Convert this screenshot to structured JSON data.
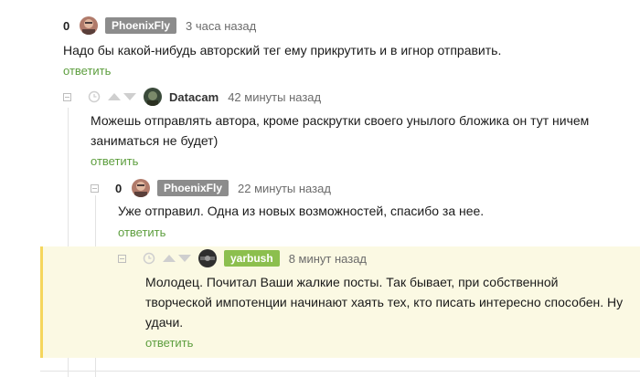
{
  "colors": {
    "reply_link": "#5d9e3e",
    "phoenix_badge": "#8c8c8c",
    "yarbush_badge": "#8cbf4e",
    "highlight_bg": "#fbf9e3",
    "highlight_border": "#f5d65c"
  },
  "comments": [
    {
      "score": "0",
      "author": "PhoenixFly",
      "time": "3 часа назад",
      "text": "Надо бы какой-нибудь авторский тег ему прикрутить и в игнор отправить.",
      "reply_label": "ответить"
    },
    {
      "author": "Datacam",
      "time": "42 минуты назад",
      "text_line1": "Можешь отправлять автора, кроме раскрутки своего унылого бложика он тут ничем",
      "text_line2": "заниматься не будет)",
      "reply_label": "ответить"
    },
    {
      "score": "0",
      "author": "PhoenixFly",
      "time": "22 минуты назад",
      "text": "Уже отправил. Одна из новых возможностей, спасибо за нее.",
      "reply_label": "ответить"
    },
    {
      "author": "yarbush",
      "time": "8 минут назад",
      "text_line1": "Молодец. Почитал Ваши жалкие посты. Так бывает, при собственной",
      "text_line2": "творческой импотенции начинают хаять тех, кто писать интересно способен. Ну",
      "text_line3": "удачи.",
      "reply_label": "ответить"
    }
  ]
}
